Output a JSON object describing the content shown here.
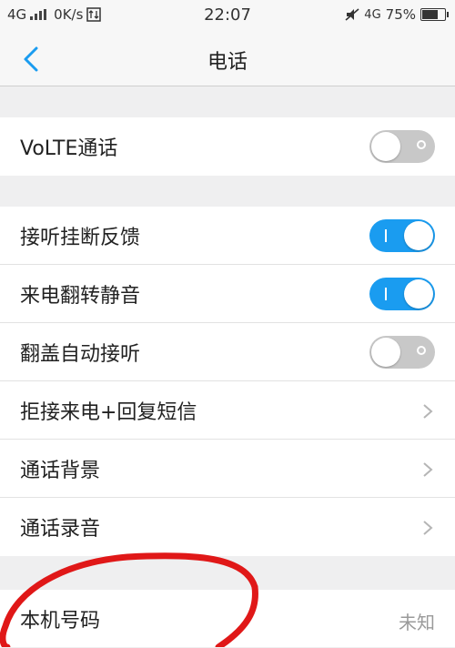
{
  "status_bar": {
    "network": "4G",
    "speed": "0K/s",
    "time": "22:07",
    "network_right": "4G",
    "battery_percent": "75%",
    "battery_level": 0.75
  },
  "header": {
    "title": "电话"
  },
  "settings": {
    "volte": {
      "label": "VoLTE通话",
      "enabled": false
    },
    "answer_hangup_feedback": {
      "label": "接听挂断反馈",
      "enabled": true
    },
    "flip_to_mute": {
      "label": "来电翻转静音",
      "enabled": true
    },
    "flip_cover_answer": {
      "label": "翻盖自动接听",
      "enabled": false
    },
    "reject_sms_reply": {
      "label": "拒接来电+回复短信"
    },
    "call_background": {
      "label": "通话背景"
    },
    "call_recording": {
      "label": "通话录音"
    },
    "my_number": {
      "label": "本机号码",
      "value": "未知"
    }
  },
  "colors": {
    "accent": "#1a9cf0",
    "toggle_off": "#c8c8c8",
    "annotation": "#e01818"
  }
}
